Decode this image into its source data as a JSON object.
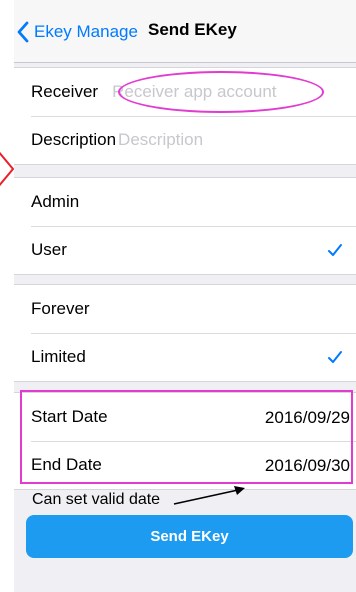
{
  "nav": {
    "back_label": "Ekey Manage",
    "title": "Send EKey"
  },
  "receiver": {
    "label": "Receiver",
    "placeholder": "Receiver app account",
    "value": ""
  },
  "description": {
    "label": "Description",
    "placeholder": "Description",
    "value": ""
  },
  "role_options": [
    {
      "label": "Admin",
      "selected": false
    },
    {
      "label": "User",
      "selected": true
    }
  ],
  "validity_options": [
    {
      "label": "Forever",
      "selected": false
    },
    {
      "label": "Limited",
      "selected": true
    }
  ],
  "dates": {
    "start_label": "Start Date",
    "start_value": "2016/09/29",
    "end_label": "End Date",
    "end_value": "2016/09/30"
  },
  "annotation": "Can set valid date",
  "send_button": "Send EKey",
  "colors": {
    "accent": "#007aff",
    "button": "#1c9bf0",
    "highlight": "#e23bd0",
    "chevron": "#e8202a"
  }
}
